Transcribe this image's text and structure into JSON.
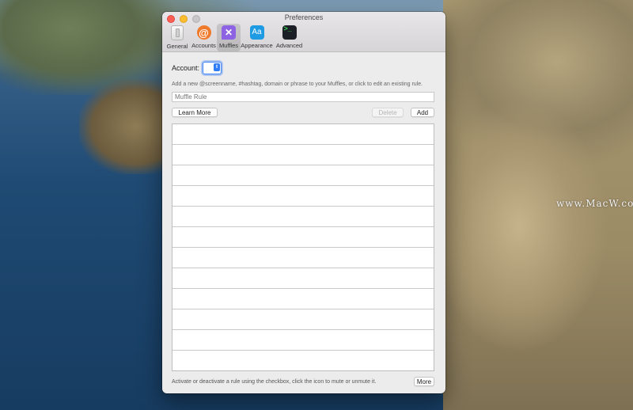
{
  "window": {
    "title": "Preferences"
  },
  "toolbar": {
    "items": [
      {
        "label": "General",
        "icon": "general-icon"
      },
      {
        "label": "Accounts",
        "icon": "at-sign-icon",
        "glyph": "@"
      },
      {
        "label": "Muffles",
        "icon": "muffle-x-icon",
        "glyph": "✕",
        "active": true
      },
      {
        "label": "Appearance",
        "icon": "appearance-aa-icon",
        "glyph": "Aa"
      },
      {
        "label": "Advanced",
        "icon": "terminal-icon",
        "glyph": ">_"
      }
    ]
  },
  "muffles": {
    "account_label": "Account:",
    "hint": "Add a new @screenname, #hashtag, domain or phrase to your Muffles, or click to edit an existing rule.",
    "rule_placeholder": "Muffle Rule",
    "rule_value": "",
    "learn_more_label": "Learn More",
    "delete_label": "Delete",
    "add_label": "Add",
    "footer_text": "Activate or deactivate a rule using the checkbox, click the icon to mute or unmute it.",
    "more_label": "More"
  },
  "desktop": {
    "watermark": "www.MacW.com"
  },
  "colors": {
    "accent": "#2f7cf6",
    "accounts_icon": "#f07a2c",
    "muffles_icon": "#8d63e3",
    "appearance_icon": "#1f9be4",
    "advanced_icon": "#1d1f26"
  }
}
